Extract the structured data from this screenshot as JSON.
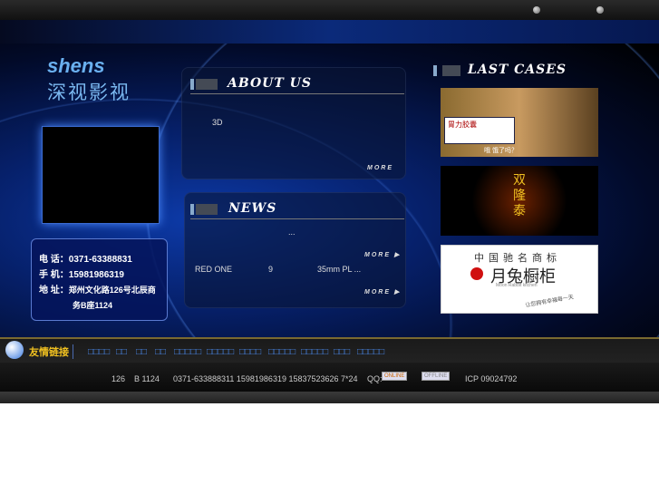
{
  "logo": {
    "brand": "shens",
    "cn": "深视影视"
  },
  "contact": {
    "tel_label": "电 话：",
    "tel": "0371-63388831",
    "mobile_label": "手 机：",
    "mobile": "15981986319",
    "addr_label": "地 址：",
    "addr1": "郑州文化路126号北辰商",
    "addr2": "务B座1124"
  },
  "about": {
    "title": "ABOUT US",
    "text": "3D",
    "more": "MORE"
  },
  "news": {
    "title": "NEWS",
    "item1": "...",
    "item2_a": "RED ONE",
    "item2_b": "9",
    "item2_c": "35mm PL ...",
    "more": "MORE"
  },
  "cases": {
    "title": "LAST CASES",
    "case1_caption": "哦  饿了吗？",
    "case2_text": "双隆泰",
    "case3_top": "中国驰名商标",
    "case3_brand": "月兔橱柜",
    "case3_en": "Moon Rabbit kitchen",
    "case3_slogan": "让您拥有幸福每一天"
  },
  "links": {
    "label": "友情链接",
    "items": [
      "□□□□",
      "□□",
      "□□",
      "□□",
      "□□□□□",
      "□□□□□",
      "□□□□",
      "□□□□□",
      "□□□□□",
      "□□□",
      "□□□□□"
    ]
  },
  "footer": {
    "addr": "126    B 1124",
    "phones": "0371-633888311 15981986319 15837523626  7*24",
    "qq": "QQ:",
    "online": "ONLINE",
    "offline": "OFFLINE",
    "icp": "ICP 09024792"
  }
}
